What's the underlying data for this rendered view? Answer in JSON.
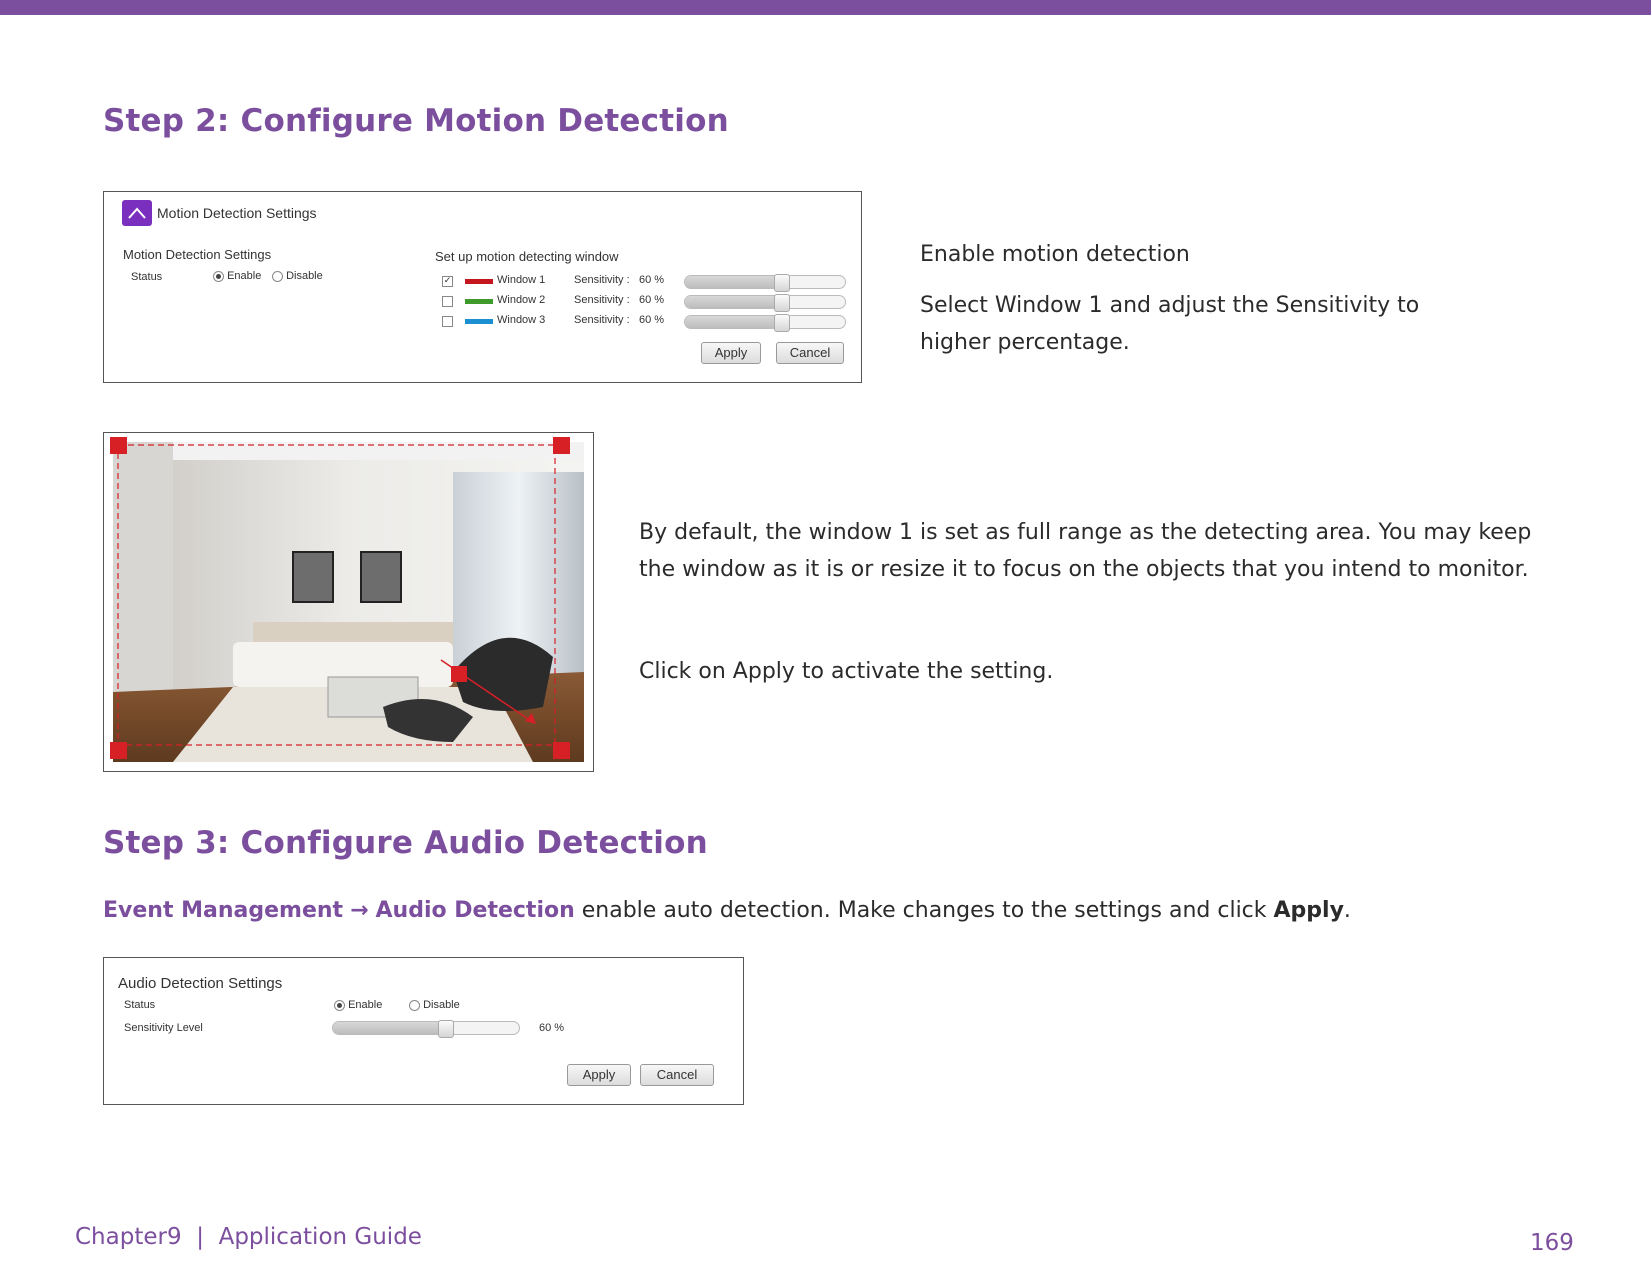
{
  "step2": {
    "heading": "Step 2: Configure Motion Detection",
    "panel": {
      "header_title": "Motion Detection Settings",
      "section_label": "Motion Detection Settings",
      "status_label": "Status",
      "enable_label": "Enable",
      "disable_label": "Disable",
      "status_value": "enable",
      "window_setup_label": "Set up motion detecting window",
      "windows": [
        {
          "label": "Window 1",
          "checked": true,
          "color": "#c4161c",
          "sensitivity_label": "Sensitivity :",
          "sensitivity_value": "60 %",
          "sensitivity_fraction": 0.6
        },
        {
          "label": "Window 2",
          "checked": false,
          "color": "#3e9a2a",
          "sensitivity_label": "Sensitivity :",
          "sensitivity_value": "60 %",
          "sensitivity_fraction": 0.6
        },
        {
          "label": "Window 3",
          "checked": false,
          "color": "#1c8fd0",
          "sensitivity_label": "Sensitivity :",
          "sensitivity_value": "60 %",
          "sensitivity_fraction": 0.6
        }
      ],
      "apply_label": "Apply",
      "cancel_label": "Cancel"
    },
    "note_enable": "Enable motion detection",
    "note_select_line1": "Select Window 1 and adjust the Sensitivity to",
    "note_select_line2": "higher percentage.",
    "note_default_line1": "By default, the window 1 is set as full range as the detecting area. You may keep",
    "note_default_line2": "the window as it is or resize it to focus on the objects that you intend to monitor.",
    "note_apply": "Click on Apply to activate the setting."
  },
  "step3": {
    "heading": "Step 3: Configure Audio Detection",
    "path_part1": "Event Management",
    "path_arrow": "→",
    "path_part2": "Audio Detection",
    "instruction_mid": " enable auto detection. Make changes to the settings and click ",
    "instruction_bold": "Apply",
    "instruction_end": ".",
    "panel": {
      "title": "Audio Detection Settings",
      "status_label": "Status",
      "enable_label": "Enable",
      "disable_label": "Disable",
      "status_value": "enable",
      "sensitivity_label": "Sensitivity Level",
      "sensitivity_value": "60 %",
      "sensitivity_fraction": 0.6,
      "apply_label": "Apply",
      "cancel_label": "Cancel"
    }
  },
  "footer": {
    "chapter": "Chapter9  |  Application Guide",
    "page_number": "169"
  },
  "colors": {
    "accent": "#7b4f9e",
    "handle": "#d71f26"
  }
}
